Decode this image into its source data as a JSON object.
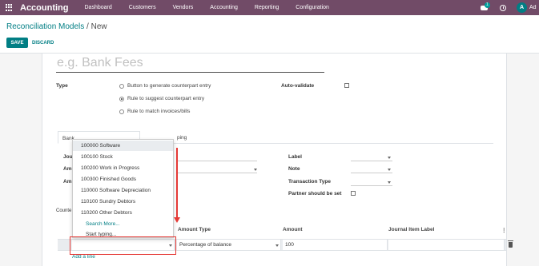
{
  "topbar": {
    "app_name": "Accounting",
    "menu": [
      "Dashboard",
      "Customers",
      "Vendors",
      "Accounting",
      "Reporting",
      "Configuration"
    ],
    "chat_badge": "1",
    "avatar_letter": "A",
    "user_name": "Ad",
    "bar_color": "#714b67"
  },
  "control_panel": {
    "breadcrumb_link": "Reconciliation Models",
    "breadcrumb_separator": " / ",
    "breadcrumb_current": "New",
    "save_label": "SAVE",
    "discard_label": "DISCARD"
  },
  "form": {
    "name_placeholder": "e.g. Bank Fees",
    "type_label": "Type",
    "type_options": [
      "Button to generate counterpart entry",
      "Rule to suggest counterpart entry",
      "Rule to match invoices/bills"
    ],
    "type_selected_index": 1,
    "auto_validate_label": "Auto-validate",
    "tabs": {
      "active_prefix": "Bank",
      "other_suffix": "ping"
    },
    "left_labels": [
      "Jou",
      "Am",
      "Am"
    ],
    "right_labels": [
      "Label",
      "Note",
      "Transaction Type",
      "Partner should be set"
    ],
    "section_label": "Counte",
    "grid": {
      "headers": [
        "Amount Type",
        "Amount",
        "Journal Item Label"
      ],
      "row": {
        "account": "",
        "amount_type": "Percentage of balance",
        "amount": "100",
        "label": ""
      },
      "add_line": "Add a line"
    }
  },
  "dropdown": {
    "items": [
      "100000 Software",
      "100100 Stock",
      "100200 Work in Progress",
      "100300 Finished Goods",
      "110000 Software Depreciation",
      "110100 Sundry Debtors",
      "110200 Other Debtors"
    ],
    "highlighted_index": 0,
    "search_more": "Search More...",
    "start_typing": "Start typing..."
  },
  "colors": {
    "primary": "#017e84",
    "annotation": "#e53935"
  }
}
